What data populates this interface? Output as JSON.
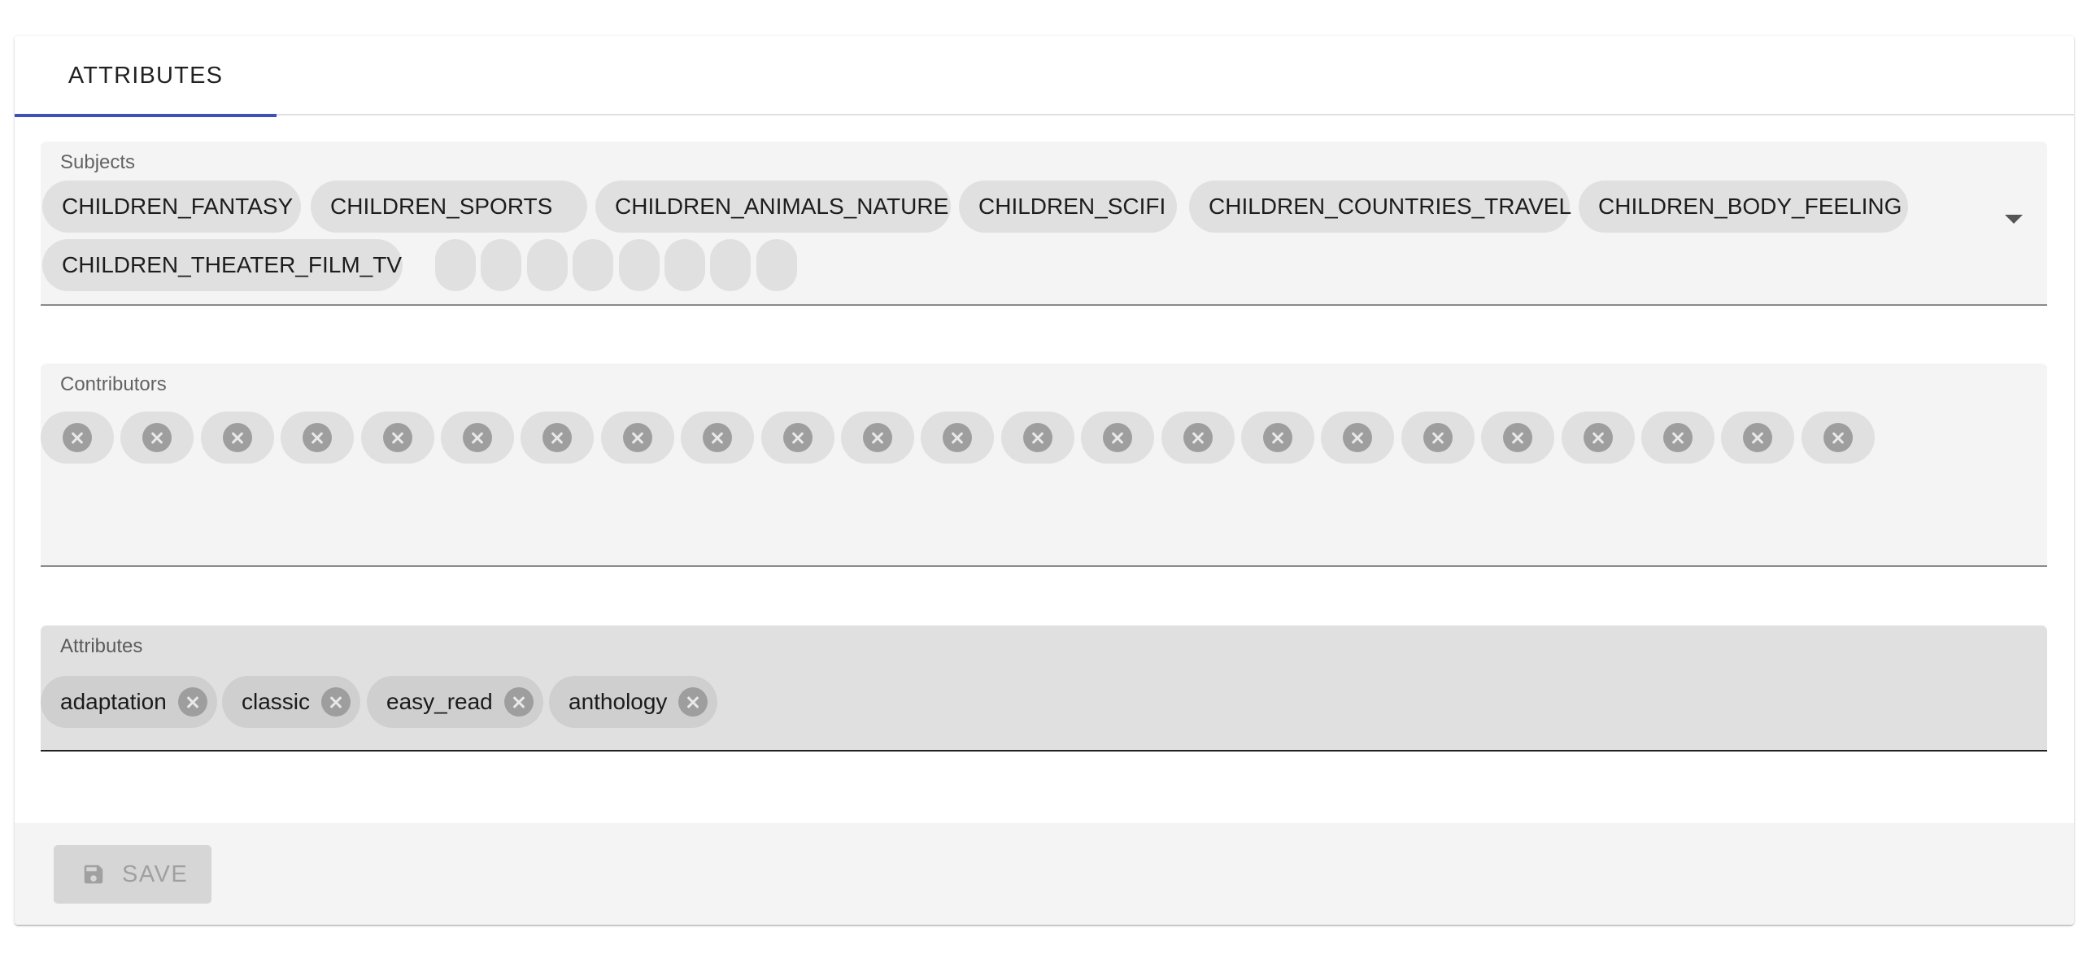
{
  "tabs": [
    {
      "label": "ATTRIBUTES",
      "active": true
    }
  ],
  "subjects": {
    "label": "Subjects",
    "chips": [
      "CHILDREN_FANTASY",
      "CHILDREN_SPORTS",
      "CHILDREN_ANIMALS_NATURE",
      "CHILDREN_SCIFI",
      "CHILDREN_COUNTRIES_TRAVEL",
      "CHILDREN_BODY_FEELING",
      "CHILDREN_THEATER_FILM_TV"
    ],
    "empty_chip_count": 8,
    "dropdown_icon": "arrow-drop-down-icon"
  },
  "contributors": {
    "label": "Contributors",
    "chip_count": 23,
    "chip_delete_icon": "cancel-icon"
  },
  "attributes": {
    "label": "Attributes",
    "chips": [
      "adaptation",
      "classic",
      "easy_read",
      "anthology"
    ],
    "chip_delete_icon": "cancel-icon"
  },
  "actions": {
    "save_label": "SAVE",
    "save_icon": "save-icon",
    "save_disabled": true
  },
  "colors": {
    "tab_indicator": "#3f51b5",
    "field_bg": "#f4f4f4",
    "chip_bg": "#e0e0e0"
  }
}
